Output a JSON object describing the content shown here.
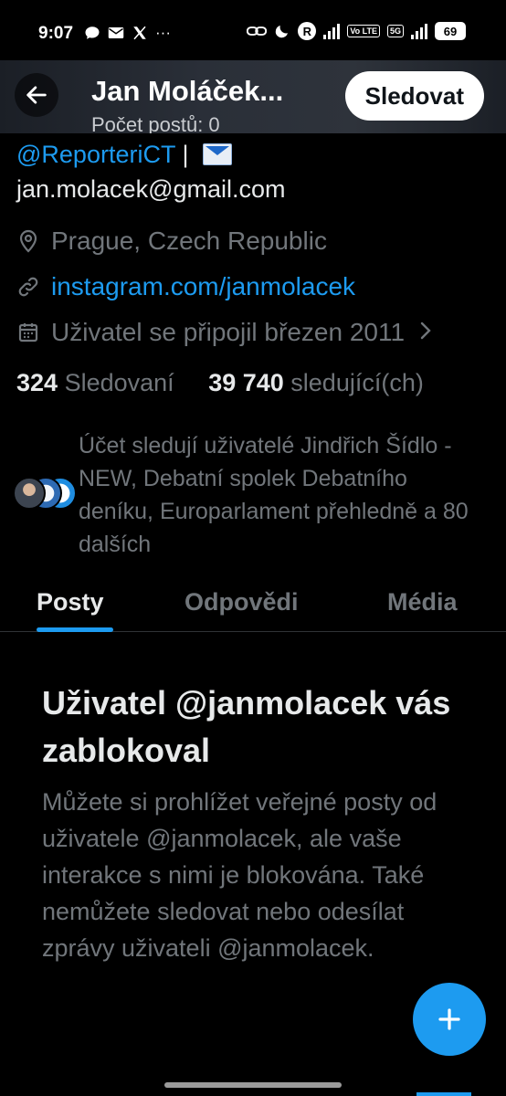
{
  "status_bar": {
    "time": "9:07",
    "notif_icons": [
      "chat-bubble-icon",
      "mail-icon",
      "x-logo-icon",
      "more-icon"
    ],
    "battery": "69",
    "net_tag_1": "Vo LTE",
    "net_tag_2": "5G"
  },
  "header": {
    "name": "Jan Moláček...",
    "subtitle": "Počet postů: 0",
    "follow_label": "Sledovat"
  },
  "bio": {
    "handle_link": "@ReporteriCT",
    "separator": " | ",
    "email": "jan.molacek@gmail.com"
  },
  "meta": {
    "location": "Prague, Czech Republic",
    "website": "instagram.com/janmolacek",
    "joined": "Uživatel se připojil březen 2011"
  },
  "stats": {
    "following_count": "324",
    "following_label": "Sledovaní",
    "followers_count": "39 740",
    "followers_label": "sledující(ch)"
  },
  "followed_by": "Účet sledují uživatelé Jindřich Šídlo - NEW, Debatní spolek Debatního deníku, Europarlament přehledně a 80 dalších",
  "tabs": [
    "Posty",
    "Odpovědi",
    "Média"
  ],
  "blocked": {
    "title": "Uživatel @janmolacek vás zablokoval",
    "body": "Můžete si prohlížet veřejné posty od uživatele @janmolacek, ale vaše interakce s nimi je blokována. Také nemůžete sledovat nebo odesílat zprávy uživateli @janmolacek."
  },
  "colors": {
    "accent": "#1d9bf0",
    "text_primary": "#e7e9ea",
    "text_secondary": "#71767b",
    "background": "#000000"
  }
}
